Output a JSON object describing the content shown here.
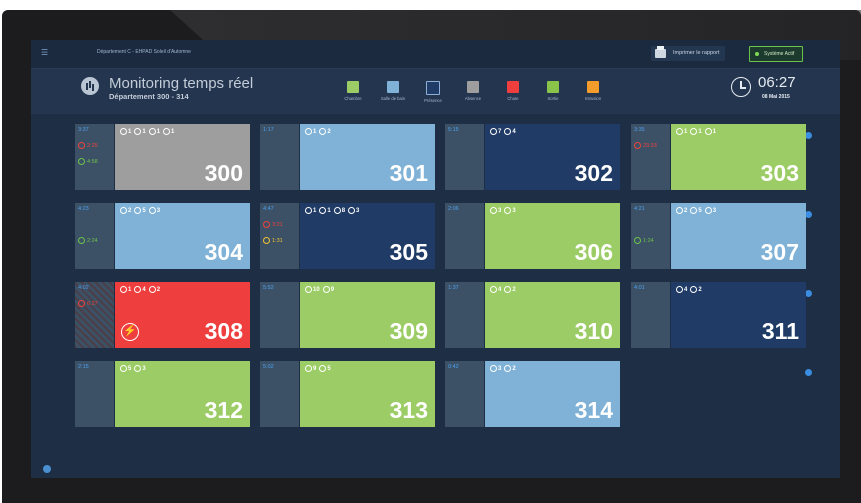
{
  "topbar": {
    "breadcrumb": "Département C - EHPAD Soleil d'Automne",
    "print_label": "Imprimer le rapport",
    "status_label": "Système Actif"
  },
  "header": {
    "title": "Monitoring temps réel",
    "subtitle": "Département 300 - 314",
    "time": "06:27",
    "date": "08 Mai 2015"
  },
  "legend": [
    {
      "label": "Chambre",
      "color": "#9ccc65"
    },
    {
      "label": "Salle de bain",
      "color": "#7fb2d6"
    },
    {
      "label": "Présence",
      "color": "#1f3b66"
    },
    {
      "label": "Absence",
      "color": "#9e9e9e"
    },
    {
      "label": "Chute",
      "color": "#ee3e3e"
    },
    {
      "label": "Sortie",
      "color": "#8ac34a"
    },
    {
      "label": "Intrusion",
      "color": "#f39c2c"
    }
  ],
  "rooms": [
    {
      "number": "300",
      "color": "#9e9e9e",
      "icons": [
        "1",
        "1",
        "1",
        "1"
      ],
      "side": [
        {
          "t": "time",
          "v": "3:37"
        },
        {
          "t": "red",
          "v": "2:25"
        },
        {
          "t": "grn",
          "v": "4:58"
        }
      ]
    },
    {
      "number": "301",
      "color": "#7fb2d6",
      "icons": [
        "1",
        "2"
      ],
      "side": [
        {
          "t": "time",
          "v": "1:17"
        }
      ]
    },
    {
      "number": "302",
      "color": "#1f3b66",
      "icons": [
        "7",
        "4"
      ],
      "side": [
        {
          "t": "time",
          "v": "5:15"
        }
      ]
    },
    {
      "number": "303",
      "color": "#9ccc65",
      "icons": [
        "1",
        "1",
        "1"
      ],
      "side": [
        {
          "t": "time",
          "v": "3:35"
        },
        {
          "t": "red",
          "v": "23:33"
        }
      ]
    },
    {
      "number": "304",
      "color": "#7fb2d6",
      "icons": [
        "2",
        "5",
        "3"
      ],
      "side": [
        {
          "t": "time",
          "v": "4:23"
        },
        {
          "t": "grn",
          "v": "2:24"
        }
      ]
    },
    {
      "number": "305",
      "color": "#1f3b66",
      "icons": [
        "1",
        "1",
        "8",
        "3"
      ],
      "side": [
        {
          "t": "time",
          "v": "4:47"
        },
        {
          "t": "red",
          "v": "3:21"
        },
        {
          "t": "yel",
          "v": "1:31"
        }
      ]
    },
    {
      "number": "306",
      "color": "#9ccc65",
      "icons": [
        "3",
        "3"
      ],
      "side": [
        {
          "t": "time",
          "v": "2:06"
        }
      ]
    },
    {
      "number": "307",
      "color": "#7fb2d6",
      "icons": [
        "2",
        "5",
        "3"
      ],
      "side": [
        {
          "t": "time",
          "v": "4:21"
        },
        {
          "t": "grn",
          "v": "1:24"
        }
      ]
    },
    {
      "number": "308",
      "color": "#ee3e3e",
      "icons": [
        "1",
        "4",
        "2"
      ],
      "side": [
        {
          "t": "time",
          "v": "4:02"
        },
        {
          "t": "red",
          "v": "6:27"
        }
      ],
      "alert": true
    },
    {
      "number": "309",
      "color": "#9ccc65",
      "icons": [
        "10",
        "9"
      ],
      "side": [
        {
          "t": "time",
          "v": "5:52"
        }
      ]
    },
    {
      "number": "310",
      "color": "#9ccc65",
      "icons": [
        "4",
        "2"
      ],
      "side": [
        {
          "t": "time",
          "v": "1:37"
        }
      ]
    },
    {
      "number": "311",
      "color": "#1f3b66",
      "icons": [
        "4",
        "2"
      ],
      "side": [
        {
          "t": "time",
          "v": "4:01"
        }
      ]
    },
    {
      "number": "312",
      "color": "#9ccc65",
      "icons": [
        "5",
        "3"
      ],
      "side": [
        {
          "t": "time",
          "v": "2:15"
        }
      ]
    },
    {
      "number": "313",
      "color": "#9ccc65",
      "icons": [
        "9",
        "5"
      ],
      "side": [
        {
          "t": "time",
          "v": "5:02"
        }
      ]
    },
    {
      "number": "314",
      "color": "#7fb2d6",
      "icons": [
        "3",
        "2"
      ],
      "side": [
        {
          "t": "time",
          "v": "0:42"
        }
      ]
    }
  ]
}
